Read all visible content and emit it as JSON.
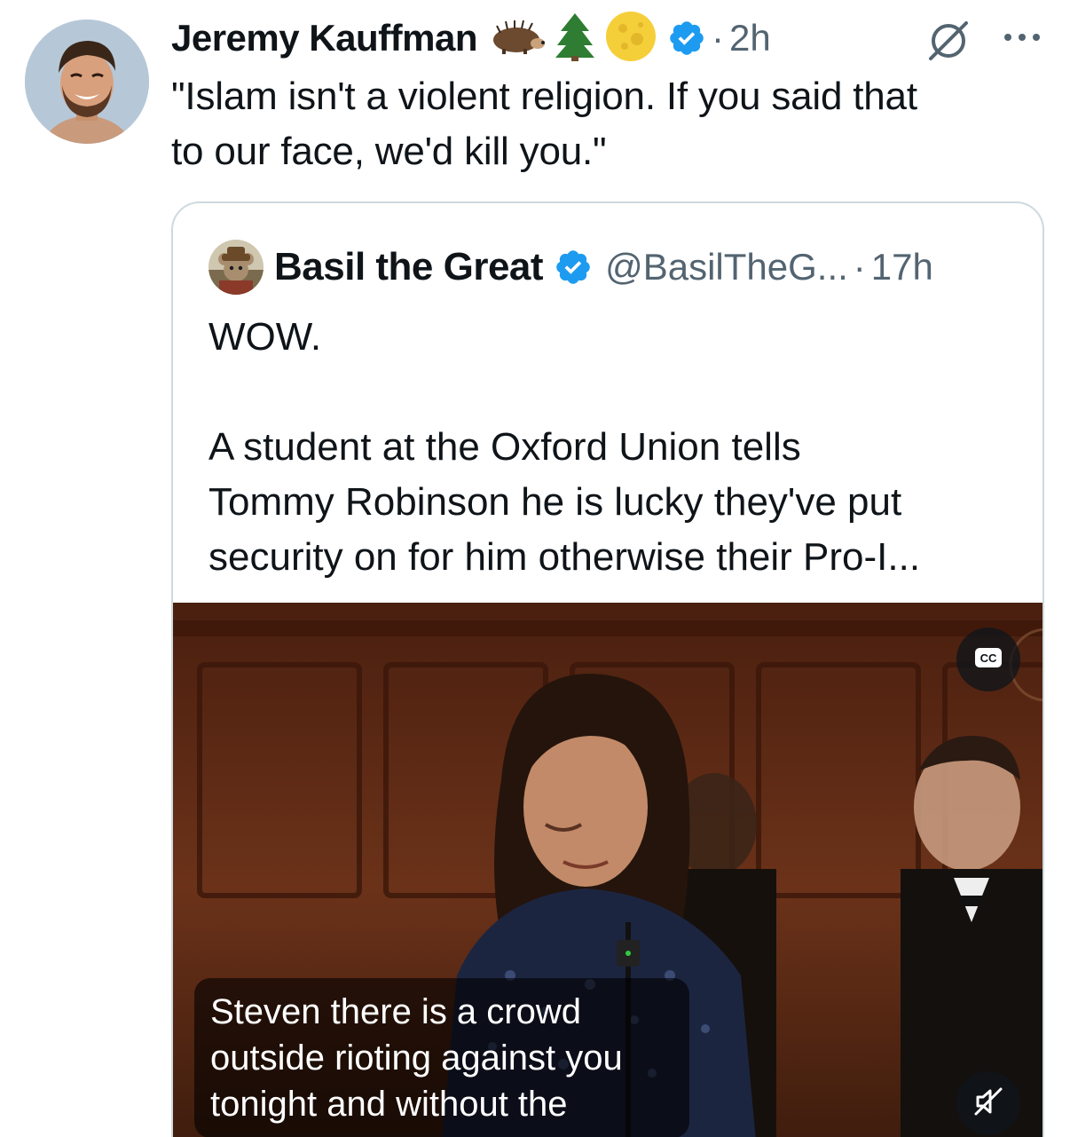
{
  "tweet": {
    "author_name": "Jeremy Kauffman",
    "emojis": [
      "hedgehog-emoji",
      "evergreen-tree-emoji",
      "full-moon-emoji"
    ],
    "verified": true,
    "separator": "·",
    "time": "2h",
    "text": "\"Islam isn't a violent religion. If you said that\nto our face, we'd kill you.\"",
    "icons": {
      "grok": "grok-icon",
      "more": "more-icon"
    }
  },
  "quote": {
    "author_name": "Basil the Great",
    "verified": true,
    "handle": "@BasilTheG...",
    "separator": "·",
    "time": "17h",
    "lead": "WOW.",
    "text": "A student at the Oxford Union tells\nTommy Robinson he is lucky they've put\nsecurity on for him otherwise their Pro-I...",
    "media": {
      "caption": "Steven there is a crowd\noutside rioting against you\ntonight and without the",
      "cc_label": "CC",
      "icons": {
        "cc": "cc-icon",
        "mute": "mute-icon"
      }
    }
  },
  "colors": {
    "text": "#0f1419",
    "secondary": "#536471",
    "verified": "#1d9bf0",
    "border": "#cfd9de"
  }
}
